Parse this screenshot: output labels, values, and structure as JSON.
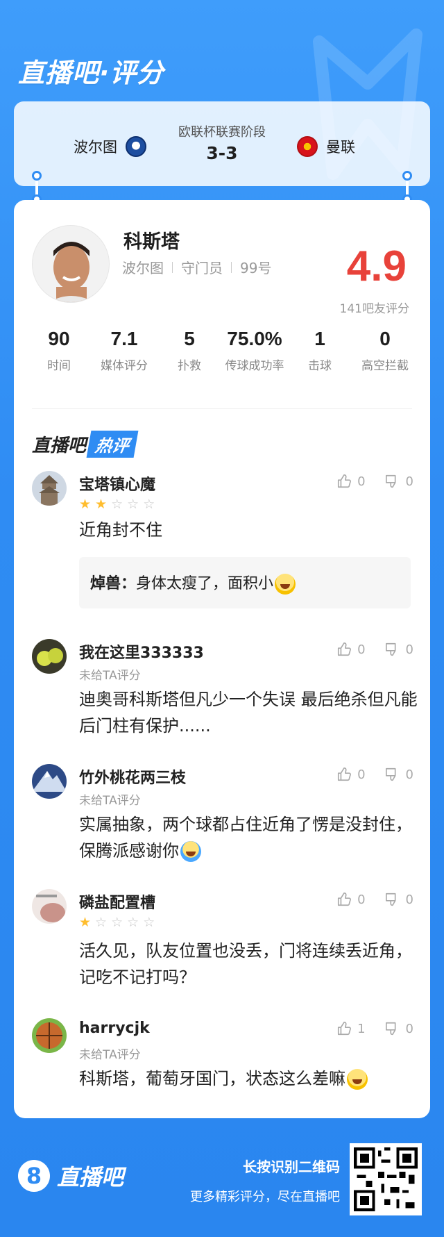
{
  "brand": {
    "title": "直播吧·评分",
    "logo_text": "直播吧",
    "logo_mark": "8"
  },
  "match": {
    "home_team": "波尔图",
    "away_team": "曼联",
    "stage": "欧联杯联赛阶段",
    "score": "3-3"
  },
  "player": {
    "name": "科斯塔",
    "team": "波尔图",
    "position": "守门员",
    "number": "99号",
    "rating": "4.9",
    "rating_caption": "141吧友评分"
  },
  "stats": [
    {
      "value": "90",
      "label": "时间"
    },
    {
      "value": "7.1",
      "label": "媒体评分"
    },
    {
      "value": "5",
      "label": "扑救"
    },
    {
      "value": "75.0%",
      "label": "传球成功率"
    },
    {
      "value": "1",
      "label": "击球"
    },
    {
      "value": "0",
      "label": "高空拦截"
    }
  ],
  "hot_section": {
    "part1": "直播吧",
    "part2": "热评"
  },
  "comments": [
    {
      "user": "宝塔镇心魔",
      "stars": 2,
      "sub": "",
      "likes": "0",
      "dislikes": "0",
      "text": "近角封不住",
      "reply": {
        "name": "焯兽：",
        "text": "身体太瘦了，面积小"
      }
    },
    {
      "user": "我在这里333333",
      "stars": 0,
      "sub": "未给TA评分",
      "likes": "0",
      "dislikes": "0",
      "text": "迪奥哥科斯塔但凡少一个失误 最后绝杀但凡能后门柱有保护......"
    },
    {
      "user": "竹外桃花两三枝",
      "stars": 0,
      "sub": "未给TA评分",
      "likes": "0",
      "dislikes": "0",
      "text": "实属抽象，两个球都占住近角了愣是没封住，保腾派感谢你"
    },
    {
      "user": "磷盐配置槽",
      "stars": 1,
      "sub": "",
      "likes": "0",
      "dislikes": "0",
      "text": "活久见，队友位置也没丢，门将连续丢近角，记吃不记打吗？"
    },
    {
      "user": "harrycjk",
      "stars": 0,
      "sub": "未给TA评分",
      "likes": "1",
      "dislikes": "0",
      "text": "科斯塔，葡萄牙国门，状态这么差嘛"
    }
  ],
  "footer": {
    "cta_main": "长按识别二维码",
    "cta_sub": "更多精彩评分，尽在直播吧"
  }
}
